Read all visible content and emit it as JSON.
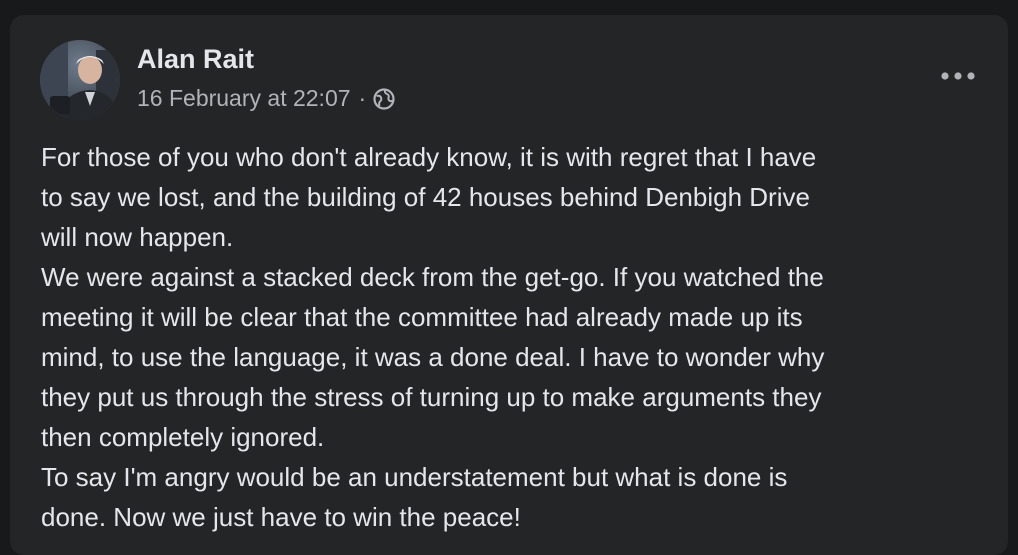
{
  "post": {
    "author": "Alan Rait",
    "timestamp": "16 February at 22:07",
    "separator": "·",
    "privacy_icon": "globe-icon",
    "more_icon": "more-horizontal-icon",
    "paragraphs": [
      "For those of you who don't already know, it is with regret that I have\nto say we lost, and the building of 42 houses behind Denbigh Drive\nwill now happen.",
      "We were against a stacked deck from the get-go. If you watched the\nmeeting it will be clear that the committee had already made up its\nmind, to use the language, it was a done deal. I have to wonder why\nthey put us through the stress of turning up to make arguments they\nthen completely ignored.",
      "To say I'm angry would be an understatement but what is done is\ndone. Now we just have to win the peace!"
    ]
  },
  "colors": {
    "page_background": "#18191a",
    "card_background": "#242526",
    "primary_text": "#e4e6eb",
    "secondary_text": "#b0b3b8"
  }
}
